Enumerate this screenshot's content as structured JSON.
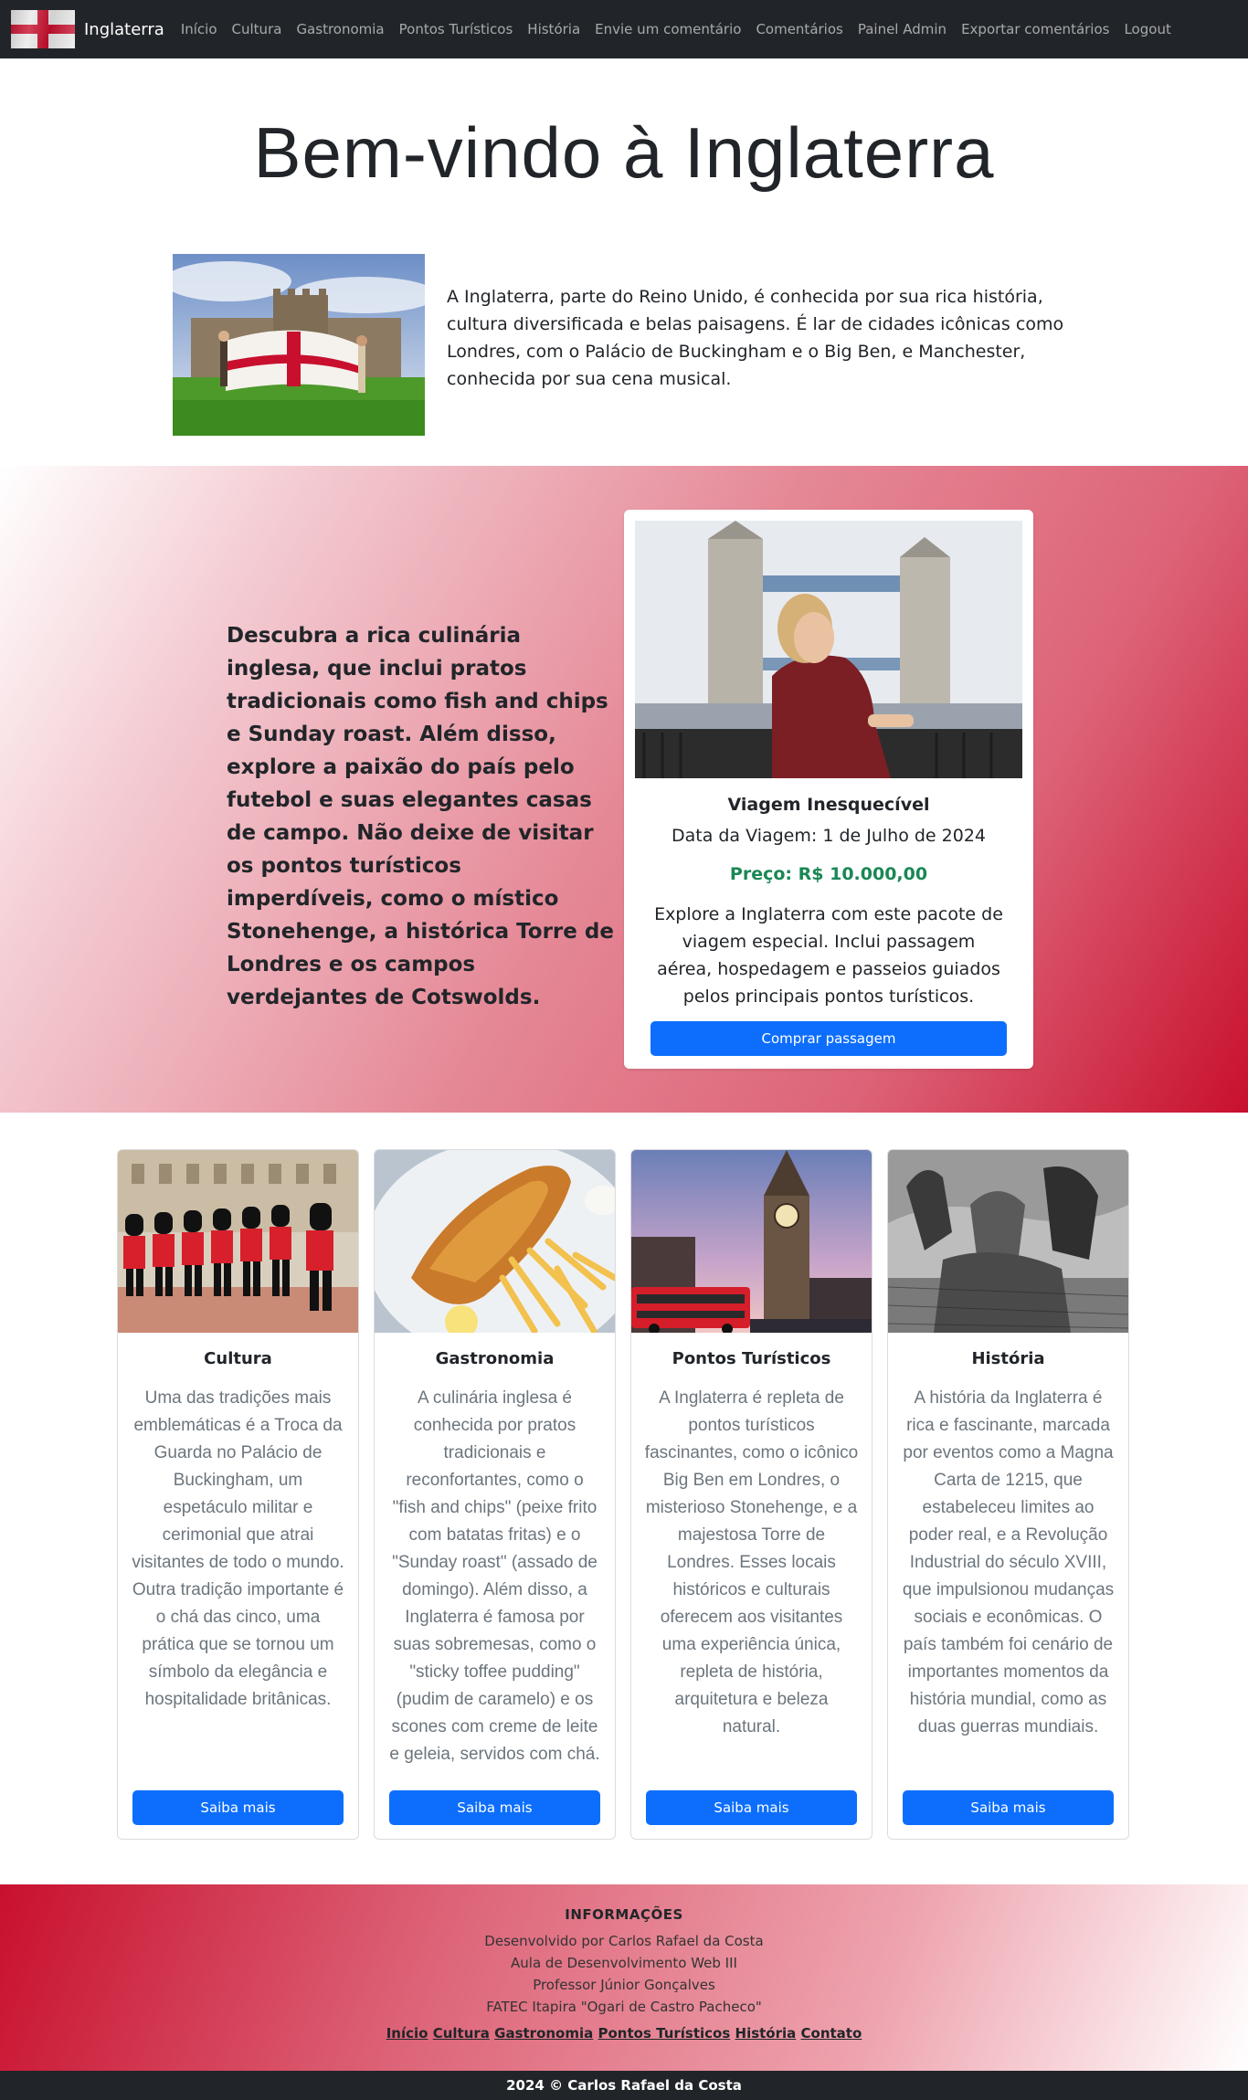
{
  "navbar": {
    "brand": "Inglaterra",
    "links": [
      "Início",
      "Cultura",
      "Gastronomia",
      "Pontos Turísticos",
      "História",
      "Envie um comentário",
      "Comentários",
      "Painel Admin",
      "Exportar comentários",
      "Logout"
    ]
  },
  "hero": {
    "title": "Bem-vindo à Inglaterra",
    "intro": "A Inglaterra, parte do Reino Unido, é conhecida por sua rica história, cultura diversificada e belas paisagens. É lar de cidades icônicas como Londres, com o Palácio de Buckingham e o Big Ben, e Manchester, conhecida por sua cena musical."
  },
  "promo": {
    "text": "Descubra a rica culinária inglesa, que inclui pratos tradicionais como fish and chips e Sunday roast. Além disso, explore a paixão do país pelo futebol e suas elegantes casas de campo. Não deixe de visitar os pontos turísticos imperdíveis, como o místico Stonehenge, a histórica Torre de Londres e os campos verdejantes de Cotswolds.",
    "card": {
      "title": "Viagem Inesquecível",
      "date": "Data da Viagem: 1 de Julho de 2024",
      "price": "Preço: R$ 10.000,00",
      "description": "Explore a Inglaterra com este pacote de viagem especial. Inclui passagem aérea, hospedagem e passeios guiados pelos principais pontos turísticos.",
      "button": "Comprar passagem"
    }
  },
  "cards": [
    {
      "title": "Cultura",
      "text": "Uma das tradições mais emblemáticas é a Troca da Guarda no Palácio de Buckingham, um espetáculo militar e cerimonial que atrai visitantes de todo o mundo. Outra tradição importante é o chá das cinco, uma prática que se tornou um símbolo da elegância e hospitalidade britânicas.",
      "button": "Saiba mais"
    },
    {
      "title": "Gastronomia",
      "text": "A culinária inglesa é conhecida por pratos tradicionais e reconfortantes, como o \"fish and chips\" (peixe frito com batatas fritas) e o \"Sunday roast\" (assado de domingo). Além disso, a Inglaterra é famosa por suas sobremesas, como o \"sticky toffee pudding\" (pudim de caramelo) e os scones com creme de leite e geleia, servidos com chá.",
      "button": "Saiba mais"
    },
    {
      "title": "Pontos Turísticos",
      "text": "A Inglaterra é repleta de pontos turísticos fascinantes, como o icônico Big Ben em Londres, o misterioso Stonehenge, e a majestosa Torre de Londres. Esses locais históricos e culturais oferecem aos visitantes uma experiência única, repleta de história, arquitetura e beleza natural.",
      "button": "Saiba mais"
    },
    {
      "title": "História",
      "text": "A história da Inglaterra é rica e fascinante, marcada por eventos como a Magna Carta de 1215, que estabeleceu limites ao poder real, e a Revolução Industrial do século XVIII, que impulsionou mudanças sociais e econômicas. O país também foi cenário de importantes momentos da história mundial, como as duas guerras mundiais.",
      "button": "Saiba mais"
    }
  ],
  "footer": {
    "heading": "INFORMAÇÕES",
    "lines": [
      "Desenvolvido por Carlos Rafael da Costa",
      "Aula de Desenvolvimento Web III",
      "Professor Júnior Gonçalves",
      "FATEC Itapira \"Ogari de Castro Pacheco\""
    ],
    "links": [
      "Início",
      "Cultura",
      "Gastronomia",
      "Pontos Turísticos",
      "História",
      "Contato"
    ],
    "copyright": "2024 © Carlos Rafael da Costa"
  },
  "colors": {
    "navbar": "#212529",
    "primary": "#0d6efd",
    "price": "#198754",
    "england_red": "#c8102e"
  }
}
